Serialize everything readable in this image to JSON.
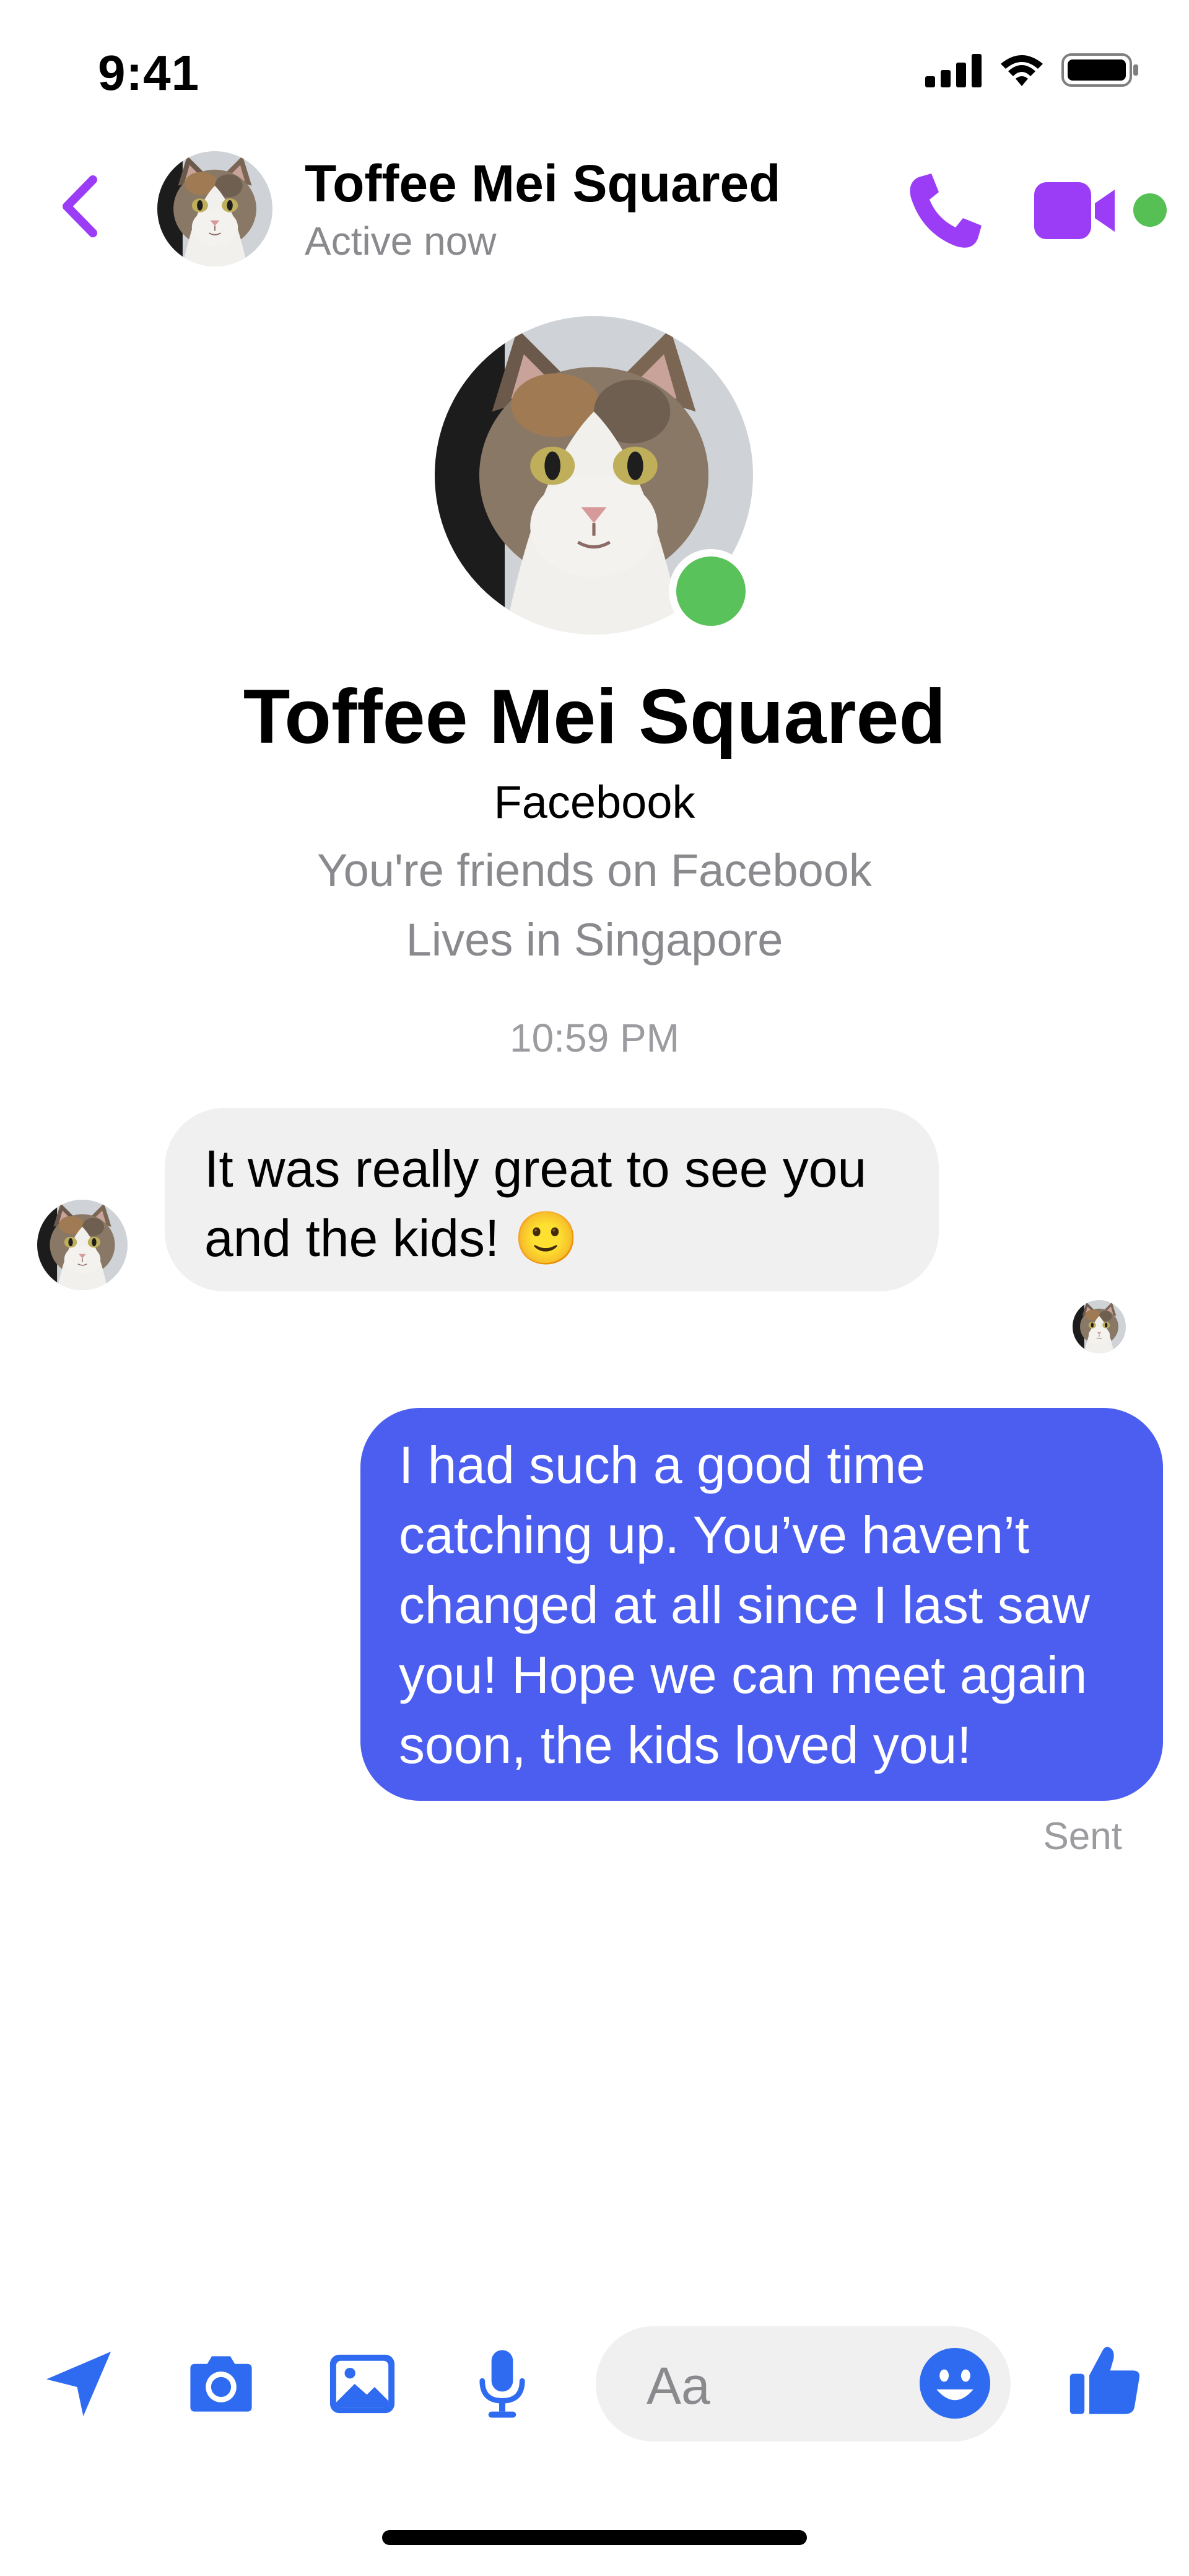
{
  "status_bar": {
    "time": "9:41"
  },
  "header": {
    "title": "Toffee Mei Squared",
    "status": "Active now",
    "accent_color": "#9b3df6"
  },
  "profile": {
    "name": "Toffee Mei Squared",
    "source": "Facebook",
    "friends_note": "You're friends on Facebook",
    "location": "Lives in Singapore"
  },
  "conversation": {
    "timestamp": "10:59 PM",
    "messages": [
      {
        "direction": "incoming",
        "text": "It was really great to see you and the kids! 🙂"
      },
      {
        "direction": "outgoing",
        "text": "I had such a good time catching up. You’ve haven’t changed at all since I last saw you! Hope we can meet again soon, the kids loved you!"
      }
    ],
    "sent_label": "Sent",
    "outgoing_color": "#4b5ef0",
    "incoming_color": "#f0f0f0"
  },
  "composer": {
    "placeholder": "Aa",
    "icons": [
      "location-arrow-icon",
      "camera-icon",
      "image-icon",
      "microphone-icon",
      "emoji-icon",
      "thumbs-up-icon"
    ],
    "icon_color": "#2f6bf0"
  }
}
